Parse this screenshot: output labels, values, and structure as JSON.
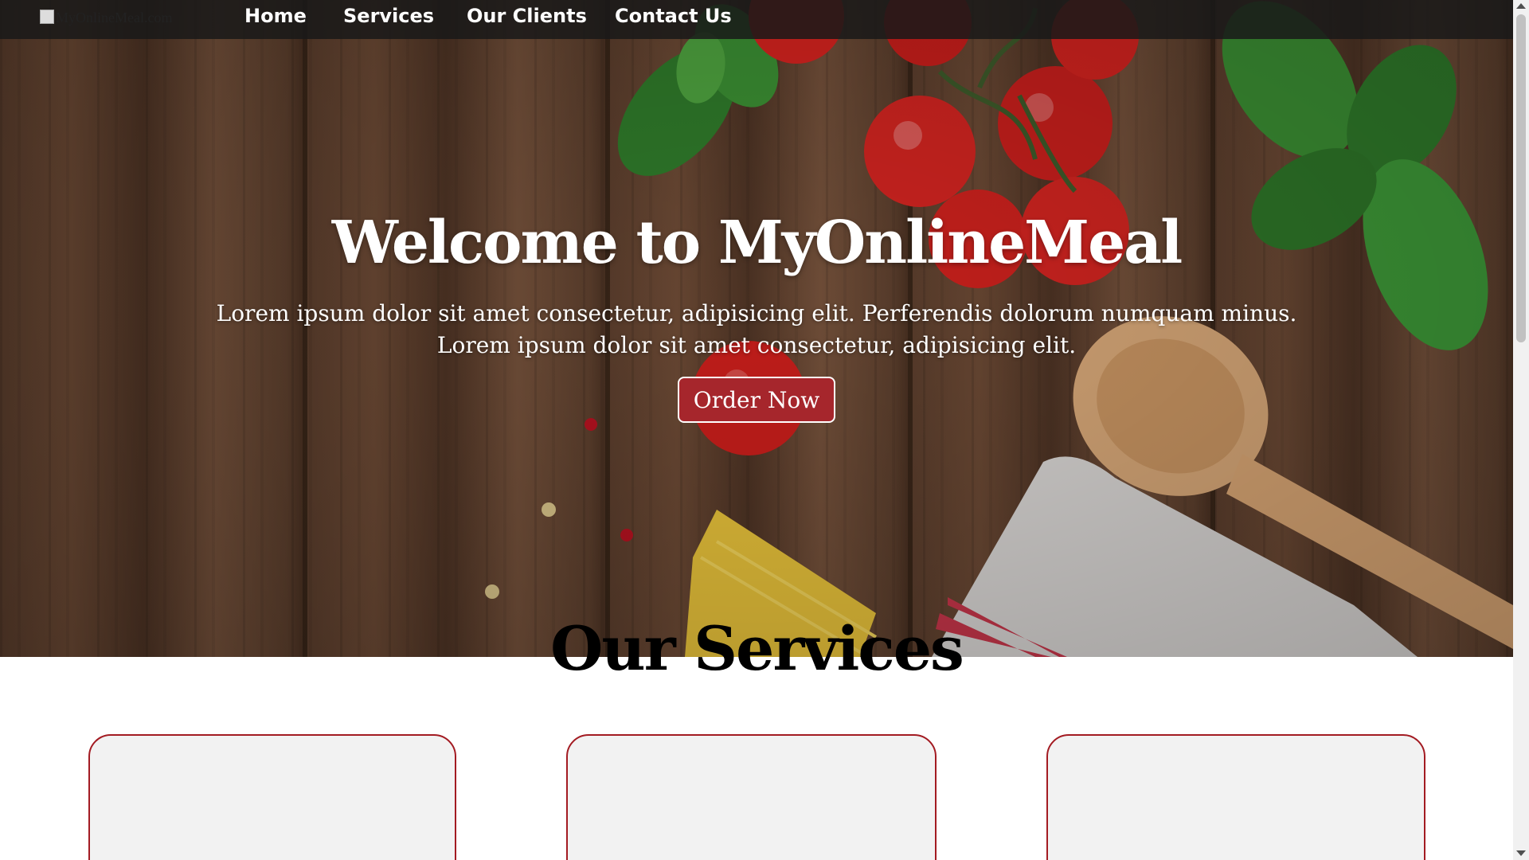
{
  "navbar": {
    "logo_alt": "MyOnlineMeal.com",
    "items": [
      {
        "label": "Home"
      },
      {
        "label": "Services"
      },
      {
        "label": "Our Clients"
      },
      {
        "label": "Contact Us"
      }
    ]
  },
  "hero": {
    "title": "Welcome to MyOnlineMeal",
    "subtitle_line1": "Lorem ipsum dolor sit amet consectetur, adipisicing elit. Perferendis dolorum numquam minus.",
    "subtitle_line2": "Lorem ipsum dolor sit amet consectetur, adipisicing elit.",
    "button_label": "Order Now"
  },
  "services": {
    "title": "Our Services",
    "card_count": 3
  },
  "colors": {
    "accent": "#a6262c",
    "card_border": "#a31b22",
    "card_bg": "#f2f2f2",
    "navbar_bg": "#191919"
  },
  "icons": {
    "logo": "broken-image-icon",
    "scroll_up": "scroll-up-arrow-icon",
    "scroll_down": "scroll-down-arrow-icon"
  }
}
